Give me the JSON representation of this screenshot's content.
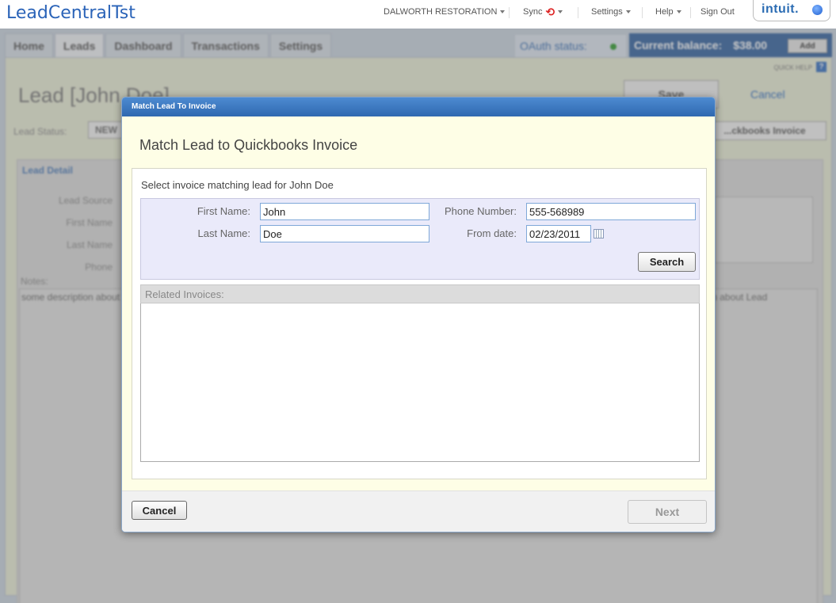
{
  "app": {
    "title": "LeadCentralTst"
  },
  "topnav": {
    "company": "DALWORTH RESTORATION",
    "sync": "Sync",
    "settings": "Settings",
    "help": "Help",
    "sign_out": "Sign Out",
    "logo_text": "intuit."
  },
  "tabs": [
    "Home",
    "Leads",
    "Dashboard",
    "Transactions",
    "Settings"
  ],
  "status_bar": {
    "oauth_label": "OAuth status:",
    "balance_label": "Current balance:",
    "balance_value": "$38.00",
    "add_label": "Add",
    "quick_help": "QUICK HELP",
    "help_icon": "?"
  },
  "lead_page": {
    "title": "Lead [John Doe]",
    "save_label": "Save",
    "cancel_label": "Cancel",
    "status_label": "Lead Status:",
    "status_value": "NEW",
    "qb_button": "...ckbooks Invoice",
    "detail_label": "Lead Detail",
    "fields": [
      "Lead Source",
      "First Name",
      "Last Name",
      "Phone"
    ],
    "notes_label": "Notes:",
    "notes_text": "some description about Lead some description about Lead some description about Lead some description about Lead some description about Lead some description about Lead"
  },
  "modal": {
    "title": "Match Lead To Invoice",
    "heading": "Match Lead to Quickbooks Invoice",
    "instruction": "Select invoice matching lead for John Doe",
    "form": {
      "first_name_label": "First Name:",
      "first_name": "John",
      "last_name_label": "Last Name:",
      "last_name": "Doe",
      "phone_label": "Phone Number:",
      "phone": "555-568989",
      "from_date_label": "From date:",
      "from_date": "02/23/2011"
    },
    "search_label": "Search",
    "related_label": "Related Invoices:",
    "cancel_label": "Cancel",
    "next_label": "Next"
  },
  "colors": {
    "brand_blue": "#2a63b8",
    "modal_header": "#3a74bc",
    "modal_bg": "#fefee6",
    "sync_red": "#d22222"
  }
}
